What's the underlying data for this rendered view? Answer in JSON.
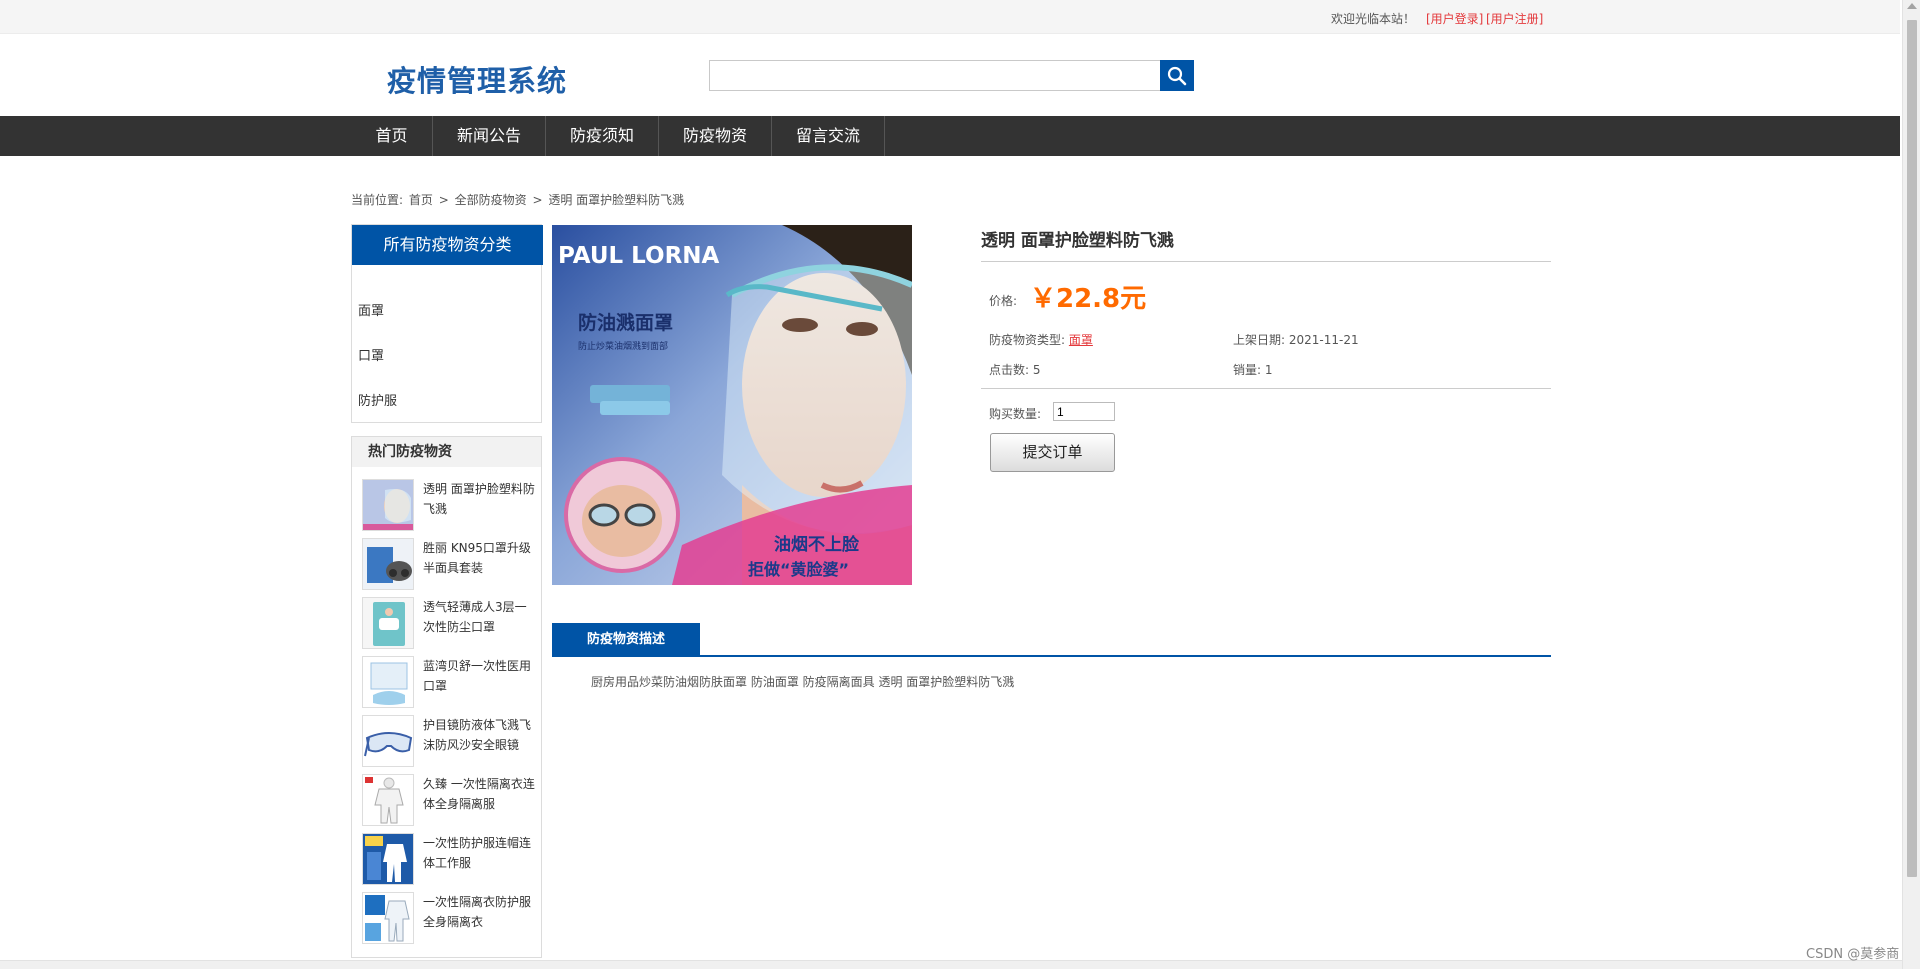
{
  "topbar": {
    "welcome": "欢迎光临本站！",
    "login": "[用户登录]",
    "register": "[用户注册]"
  },
  "header": {
    "logo": "疫情管理系统",
    "search_value": ""
  },
  "nav": [
    "首页",
    "新闻公告",
    "防疫须知",
    "防疫物资",
    "留言交流"
  ],
  "breadcrumb": {
    "prefix": "当前位置:",
    "home": "首页",
    "category": "全部防疫物资",
    "current": "透明 面罩护脸塑料防飞溅",
    "separator": ">"
  },
  "sidebar": {
    "categories_title": "所有防疫物资分类",
    "categories": [
      "面罩",
      "口罩",
      "防护服"
    ],
    "hot_title": "热门防疫物资",
    "hot_items": [
      "透明 面罩护脸塑料防飞溅",
      "胜丽 KN95口罩升级半面具套装",
      "透气轻薄成人3层一次性防尘口罩",
      "蓝湾贝舒一次性医用口罩",
      "护目镜防液体飞溅飞沫防风沙安全眼镜",
      "久臻 一次性隔离衣连体全身隔离服",
      "一次性防护服连帽连体工作服",
      "一次性隔离衣防护服全身隔离衣"
    ]
  },
  "product": {
    "image_text": {
      "brand": "PAUL LORNA",
      "slogan": "防油溅面罩",
      "tagline": "防止炒菜油烟溅到面部",
      "bottom1": "油烟不上脸",
      "bottom2": "拒做“黄脸婆”"
    },
    "title": "透明 面罩护脸塑料防飞溅",
    "price_label": "价格:",
    "price": "￥22.8元",
    "type_label": "防疫物资类型:",
    "type_value": "面罩",
    "date_label": "上架日期:",
    "date_value": "2021-11-21",
    "clicks_label": "点击数:",
    "clicks_value": "5",
    "sales_label": "销量:",
    "sales_value": "1",
    "qty_label": "购买数量:",
    "qty_value": "1",
    "submit_label": "提交订单"
  },
  "description": {
    "tab": "防疫物资描述",
    "text": "厨房用品炒菜防油烟防肤面罩 防油面罩 防疫隔离面具 透明 面罩护脸塑料防飞溅"
  },
  "watermark": "CSDN @莫参商",
  "colors": {
    "brand_blue": "#0054a6",
    "logo_blue": "#1f5fa8",
    "nav_bg": "#333333",
    "price_orange": "#ff6a00",
    "link_red": "#e4393c"
  }
}
